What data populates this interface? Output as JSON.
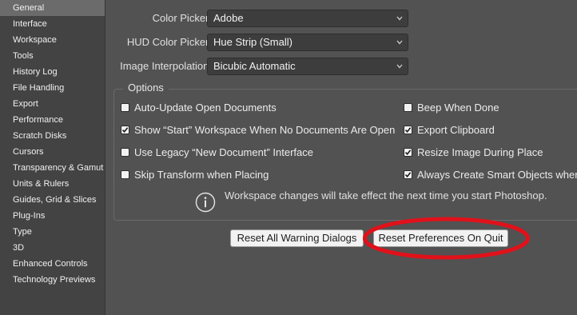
{
  "sidebar": {
    "items": [
      {
        "label": "General",
        "selected": true
      },
      {
        "label": "Interface"
      },
      {
        "label": "Workspace"
      },
      {
        "label": "Tools"
      },
      {
        "label": "History Log"
      },
      {
        "label": "File Handling"
      },
      {
        "label": "Export"
      },
      {
        "label": "Performance"
      },
      {
        "label": "Scratch Disks"
      },
      {
        "label": "Cursors"
      },
      {
        "label": "Transparency & Gamut"
      },
      {
        "label": "Units & Rulers"
      },
      {
        "label": "Guides, Grid & Slices"
      },
      {
        "label": "Plug-Ins"
      },
      {
        "label": "Type"
      },
      {
        "label": "3D"
      },
      {
        "label": "Enhanced Controls"
      },
      {
        "label": "Technology Previews"
      }
    ]
  },
  "fields": {
    "color_picker": {
      "label": "Color Picker:",
      "value": "Adobe"
    },
    "hud_color_picker": {
      "label": "HUD Color Picker:",
      "value": "Hue Strip (Small)"
    },
    "image_interpolation": {
      "label": "Image Interpolation:",
      "value": "Bicubic Automatic"
    }
  },
  "options": {
    "title": "Options",
    "left": [
      {
        "label": "Auto-Update Open Documents",
        "checked": false
      },
      {
        "label": "Show “Start” Workspace When No Documents Are Open",
        "checked": true
      },
      {
        "label": "Use Legacy “New Document” Interface",
        "checked": false
      },
      {
        "label": "Skip Transform when Placing",
        "checked": false
      }
    ],
    "right": [
      {
        "label": "Beep When Done",
        "checked": false
      },
      {
        "label": "Export Clipboard",
        "checked": true
      },
      {
        "label": "Resize Image During Place",
        "checked": true
      },
      {
        "label": "Always Create Smart Objects when",
        "checked": true
      }
    ]
  },
  "info": {
    "icon": "info-icon",
    "text": "Workspace changes will take effect the next time you start Photoshop."
  },
  "buttons": {
    "reset_warning": "Reset All Warning Dialogs",
    "reset_preferences": "Reset Preferences On Quit"
  },
  "colors": {
    "panel_bg": "#525252",
    "sidebar_bg": "#434343",
    "selected_item": "#6b6b6b",
    "highlight_ellipse": "#e0111a"
  }
}
